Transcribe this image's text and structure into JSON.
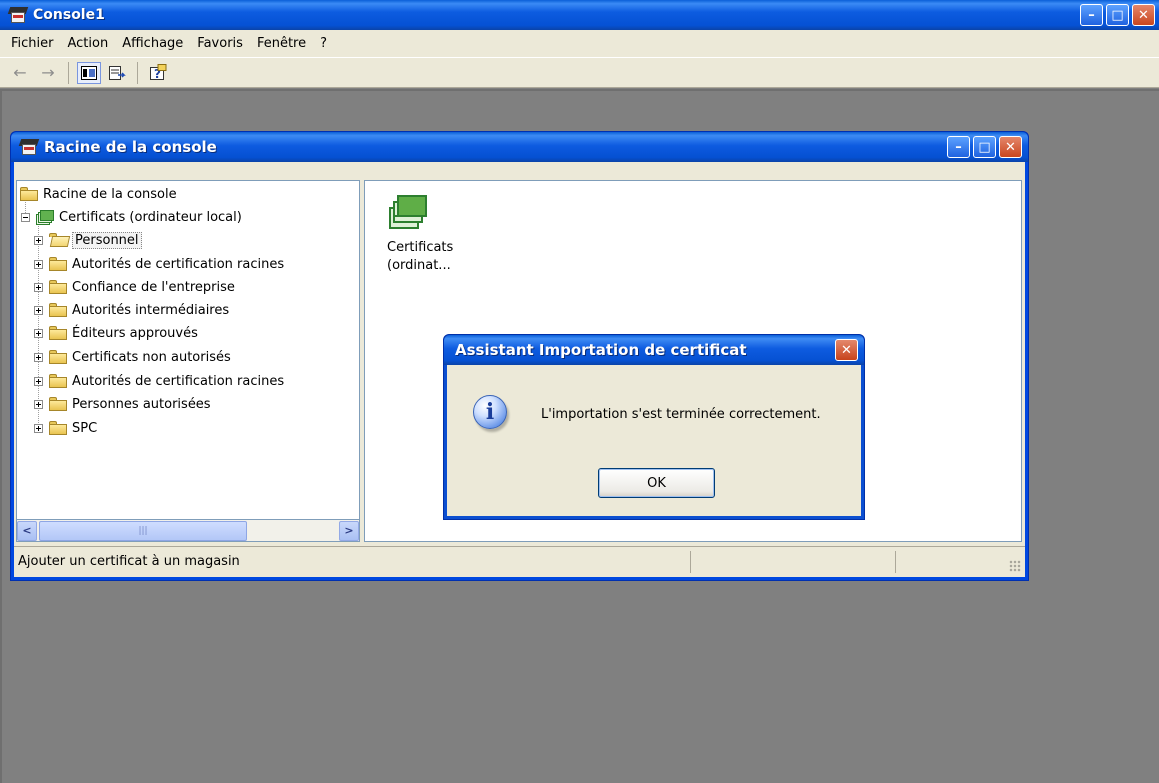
{
  "app": {
    "title": "Console1"
  },
  "menubar": {
    "items": [
      "Fichier",
      "Action",
      "Affichage",
      "Favoris",
      "Fenêtre",
      "?"
    ]
  },
  "toolbar": {
    "tools": [
      "back-arrow-icon",
      "forward-arrow-icon",
      "show-hide-tree-icon",
      "export-list-icon",
      "help-icon"
    ]
  },
  "child_window": {
    "title": "Racine de la console",
    "tree": {
      "root": "Racine de la console",
      "store": "Certificats (ordinateur local)",
      "children": [
        "Personnel",
        "Autorités de certification racines",
        "Confiance de l'entreprise",
        "Autorités intermédiaires",
        "Éditeurs approuvés",
        "Certificats non autorisés",
        "Autorités de certification racines",
        "Personnes autorisées",
        "SPC"
      ],
      "selected": "Personnel"
    },
    "list_item": {
      "line1": "Certificats",
      "line2": "(ordinat..."
    },
    "status": "Ajouter un certificat à un magasin"
  },
  "dialog": {
    "title": "Assistant Importation de certificat",
    "message": "L'importation s'est terminée correctement.",
    "ok_label": "OK"
  },
  "colors": {
    "titlebar": "#0551d4",
    "desktop": "#808080",
    "chrome": "#ece9d8"
  }
}
